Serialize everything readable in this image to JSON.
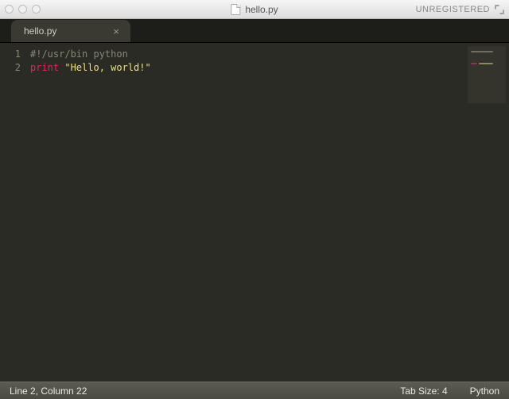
{
  "titlebar": {
    "filename": "hello.py",
    "registration": "UNREGISTERED"
  },
  "tabs": [
    {
      "label": "hello.py"
    }
  ],
  "code": {
    "lines": [
      {
        "n": "1",
        "tokens": [
          {
            "cls": "c-comment",
            "txt": "#!/usr/bin python"
          }
        ]
      },
      {
        "n": "2",
        "tokens": [
          {
            "cls": "c-keyword",
            "txt": "print"
          },
          {
            "cls": "",
            "txt": " "
          },
          {
            "cls": "c-string",
            "txt": "\"Hello, world!\""
          }
        ]
      }
    ]
  },
  "status": {
    "position": "Line 2, Column 22",
    "tabsize": "Tab Size: 4",
    "language": "Python"
  }
}
